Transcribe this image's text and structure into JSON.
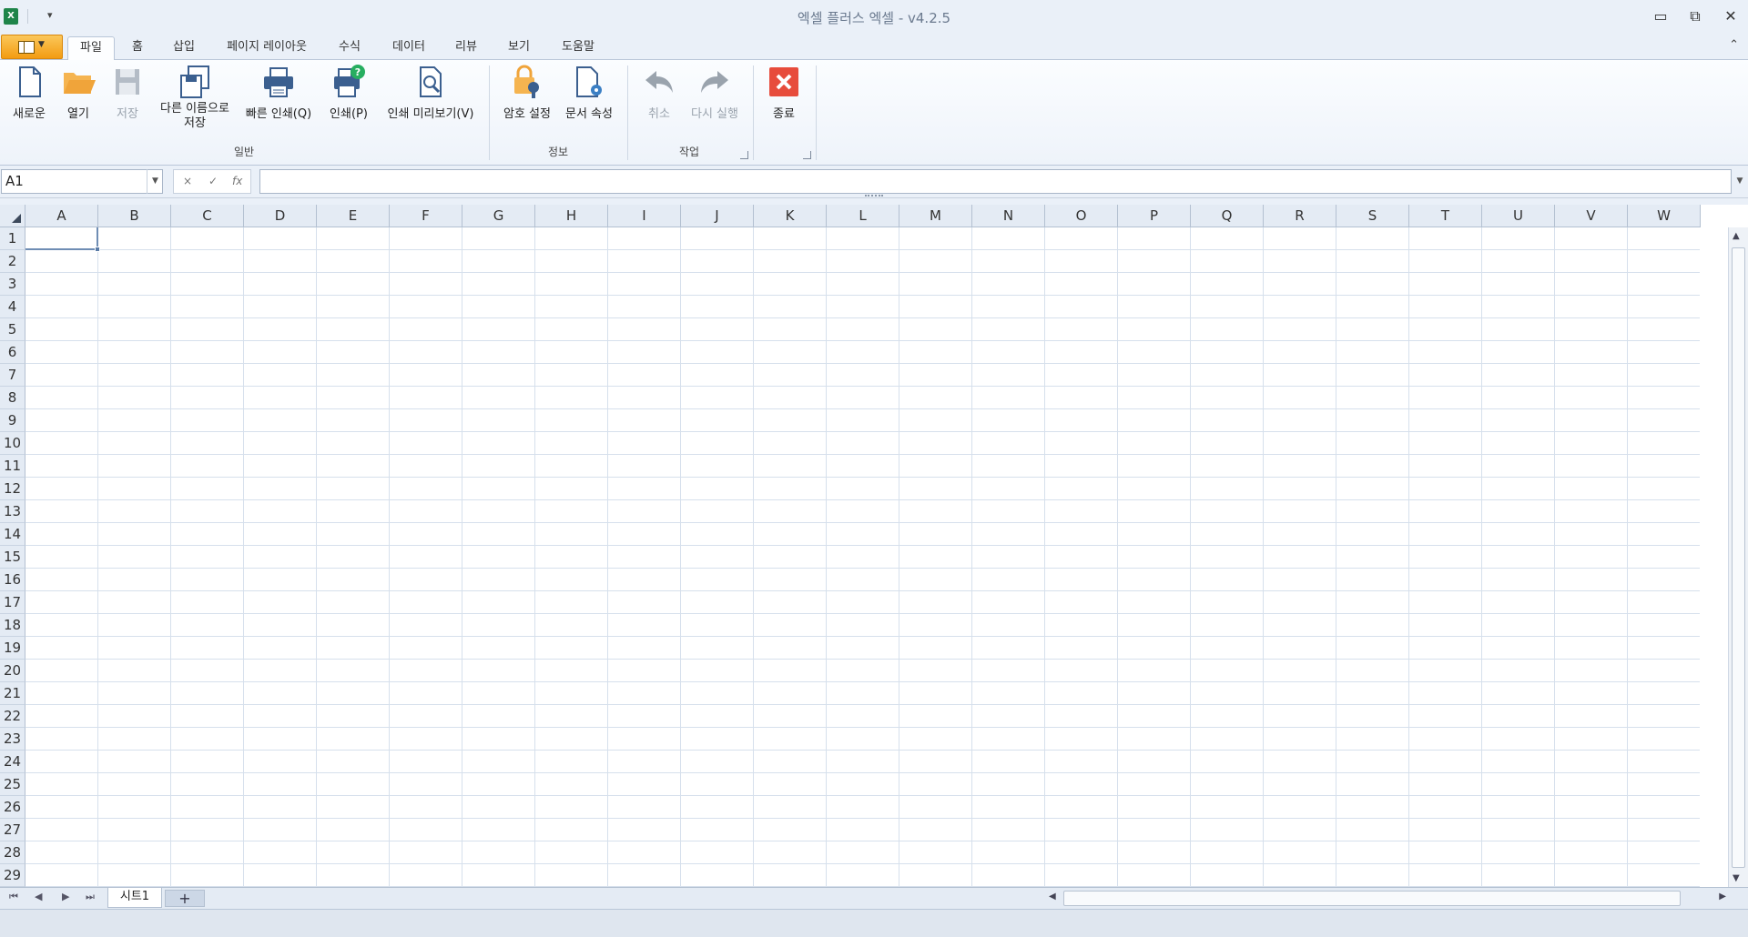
{
  "window": {
    "title": "엑셀 플러스 엑셀 - v4.2.5",
    "app_icon_letter": "X",
    "minimize": "▭",
    "restore": "⧉",
    "close": "✕"
  },
  "tabs": [
    "파일",
    "홈",
    "삽입",
    "페이지 레이아웃",
    "수식",
    "데이터",
    "리뷰",
    "보기",
    "도움말"
  ],
  "active_tab": "파일",
  "ribbon": {
    "buttons": {
      "new": "새로운",
      "open": "열기",
      "save": "저장",
      "save_as_1": "다른 이름으로",
      "save_as_2": "저장",
      "quick_print": "빠른 인쇄(Q)",
      "print": "인쇄(P)",
      "print_preview": "인쇄 미리보기(V)",
      "password": "암호 설정",
      "doc_props": "문서 속성",
      "undo": "취소",
      "redo": "다시 실행",
      "exit": "종료"
    },
    "groups": {
      "general": "일반",
      "info": "정보",
      "actions": "작업"
    }
  },
  "formula_bar": {
    "name_box": "A1",
    "formula": "",
    "cancel": "×",
    "enter": "✓",
    "fx": "fx"
  },
  "grid": {
    "columns": [
      "A",
      "B",
      "C",
      "D",
      "E",
      "F",
      "G",
      "H",
      "I",
      "J",
      "K",
      "L",
      "M",
      "N",
      "O",
      "P",
      "Q",
      "R",
      "S",
      "T",
      "U",
      "V",
      "W"
    ],
    "rows": [
      "1",
      "2",
      "3",
      "4",
      "5",
      "6",
      "7",
      "8",
      "9",
      "10",
      "11",
      "12",
      "13",
      "14",
      "15",
      "16",
      "17",
      "18",
      "19",
      "20",
      "21",
      "22",
      "23",
      "24",
      "25",
      "26",
      "27",
      "28",
      "29"
    ],
    "selected_cell": "A1"
  },
  "sheets": {
    "tabs": [
      "시트1"
    ],
    "add": "+",
    "nav": [
      "⏮",
      "◀",
      "▶",
      "⏭"
    ]
  },
  "colors": {
    "accent": "#f39c12",
    "exit_red": "#e74c3c",
    "icon_blue": "#3b5f8f",
    "folder_orange": "#f0a43a"
  }
}
